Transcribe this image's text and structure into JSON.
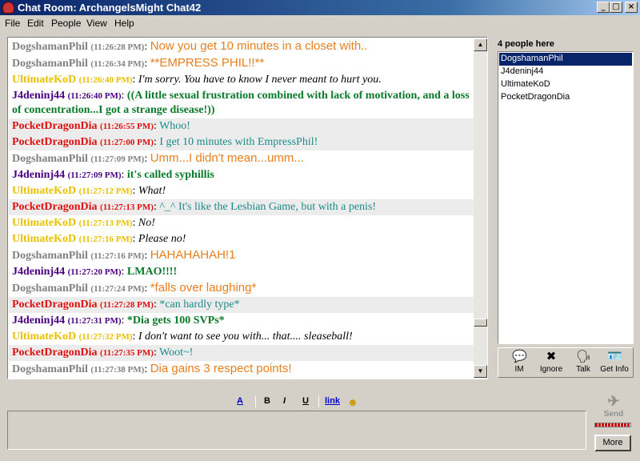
{
  "window": {
    "title": "Chat Room: ArchangelsMight Chat42"
  },
  "menu": [
    "File",
    "Edit",
    "People",
    "View",
    "Help"
  ],
  "messages": [
    {
      "nick": "DogshamanPhil",
      "time": "(11:26:28 PM)",
      "text": "Now you get 10 minutes in a closet with..",
      "nick_color": "#808080",
      "text_color": "#e87f1e",
      "text_font": "sans",
      "text_style": "normal",
      "shade": false
    },
    {
      "nick": "DogshamanPhil",
      "time": "(11:26:34 PM)",
      "text": "**EMPRESS PHIL!!**",
      "nick_color": "#808080",
      "text_color": "#e87f1e",
      "text_font": "sans",
      "text_style": "normal",
      "shade": false
    },
    {
      "nick": "UltimateKoD",
      "time": "(11:26:40 PM)",
      "text": "I'm sorry. You have to know I never meant to hurt you.",
      "nick_color": "#e8c000",
      "text_color": "#000000",
      "text_font": "serif",
      "text_style": "italic",
      "shade": false
    },
    {
      "nick": "J4deninj44",
      "time": "(11:26:40 PM)",
      "text": "((A little sexual frustration combined with lack of motivation, and a loss of concentration...I got a strange disease!))",
      "nick_color": "#4b0082",
      "text_color": "#0a7a2a",
      "text_font": "serif",
      "text_style": "bold",
      "shade": false
    },
    {
      "nick": "PocketDragonDia",
      "time": "(11:26:55 PM)",
      "text": "Whoo!",
      "nick_color": "#e01010",
      "text_color": "#1a8a8a",
      "text_font": "serif",
      "text_style": "normal",
      "shade": true
    },
    {
      "nick": "PocketDragonDia",
      "time": "(11:27:00 PM)",
      "text": "I get 10 minutes with EmpressPhil!",
      "nick_color": "#e01010",
      "text_color": "#1a8a8a",
      "text_font": "serif",
      "text_style": "normal",
      "shade": true
    },
    {
      "nick": "DogshamanPhil",
      "time": "(11:27:09 PM)",
      "text": "Umm...I didn't mean...umm...",
      "nick_color": "#808080",
      "text_color": "#e87f1e",
      "text_font": "sans",
      "text_style": "normal",
      "shade": false
    },
    {
      "nick": "J4deninj44",
      "time": "(11:27:09 PM)",
      "text": "it's called syphillis",
      "nick_color": "#4b0082",
      "text_color": "#0a7a2a",
      "text_font": "serif",
      "text_style": "bold",
      "shade": false
    },
    {
      "nick": "UltimateKoD",
      "time": "(11:27:12 PM)",
      "text": "What!",
      "nick_color": "#e8c000",
      "text_color": "#000000",
      "text_font": "serif",
      "text_style": "italic",
      "shade": false
    },
    {
      "nick": "PocketDragonDia",
      "time": "(11:27:13 PM)",
      "text": "^_^ It's like the Lesbian Game, but with a penis!",
      "nick_color": "#e01010",
      "text_color": "#1a8a8a",
      "text_font": "serif",
      "text_style": "normal",
      "shade": true
    },
    {
      "nick": "UltimateKoD",
      "time": "(11:27:13 PM)",
      "text": "No!",
      "nick_color": "#e8c000",
      "text_color": "#000000",
      "text_font": "serif",
      "text_style": "italic",
      "shade": false
    },
    {
      "nick": "UltimateKoD",
      "time": "(11:27:16 PM)",
      "text": "Please no!",
      "nick_color": "#e8c000",
      "text_color": "#000000",
      "text_font": "serif",
      "text_style": "italic",
      "shade": false
    },
    {
      "nick": "DogshamanPhil",
      "time": "(11:27:16 PM)",
      "text": "HAHAHAHAH!1",
      "nick_color": "#808080",
      "text_color": "#e87f1e",
      "text_font": "sans",
      "text_style": "normal",
      "shade": false
    },
    {
      "nick": "J4deninj44",
      "time": "(11:27:20 PM)",
      "text": "LMAO!!!!",
      "nick_color": "#4b0082",
      "text_color": "#0a7a2a",
      "text_font": "serif",
      "text_style": "bold",
      "shade": false
    },
    {
      "nick": "DogshamanPhil",
      "time": "(11:27:24 PM)",
      "text": "*falls over laughing*",
      "nick_color": "#808080",
      "text_color": "#e87f1e",
      "text_font": "sans",
      "text_style": "normal",
      "shade": false
    },
    {
      "nick": "PocketDragonDia",
      "time": "(11:27:28 PM)",
      "text": "*can hardly type*",
      "nick_color": "#e01010",
      "text_color": "#1a8a8a",
      "text_font": "serif",
      "text_style": "normal",
      "shade": true
    },
    {
      "nick": "J4deninj44",
      "time": "(11:27:31 PM)",
      "text": "*Dia gets 100 SVPs*",
      "nick_color": "#4b0082",
      "text_color": "#0a7a2a",
      "text_font": "serif",
      "text_style": "bold",
      "shade": false
    },
    {
      "nick": "UltimateKoD",
      "time": "(11:27:32 PM)",
      "text": "I don't want to see you with... that.... sleaseball!",
      "nick_color": "#e8c000",
      "text_color": "#000000",
      "text_font": "serif",
      "text_style": "italic",
      "shade": false
    },
    {
      "nick": "PocketDragonDia",
      "time": "(11:27:35 PM)",
      "text": "Woot~!",
      "nick_color": "#e01010",
      "text_color": "#1a8a8a",
      "text_font": "serif",
      "text_style": "normal",
      "shade": true
    },
    {
      "nick": "DogshamanPhil",
      "time": "(11:27:38 PM)",
      "text": "Dia gains 3 respect points!",
      "nick_color": "#808080",
      "text_color": "#e87f1e",
      "text_font": "sans",
      "text_style": "normal",
      "shade": false
    }
  ],
  "people": {
    "count_label": "4 people here",
    "list": [
      "DogshamanPhil",
      "J4deninj44",
      "UltimateKoD",
      "PocketDragonDia"
    ],
    "selected": "DogshamanPhil"
  },
  "actions": [
    {
      "label": "IM",
      "icon": "im-icon"
    },
    {
      "label": "Ignore",
      "icon": "ignore-icon"
    },
    {
      "label": "Talk",
      "icon": "talk-icon"
    },
    {
      "label": "Get Info",
      "icon": "get-info-icon"
    }
  ],
  "format": {
    "font_color": "A",
    "bold": "B",
    "italic": "I",
    "underline": "U",
    "link": "link",
    "smiley_icon": "smiley-icon"
  },
  "compose": {
    "value": ""
  },
  "send": {
    "label": "Send"
  },
  "more": {
    "label": "More"
  }
}
